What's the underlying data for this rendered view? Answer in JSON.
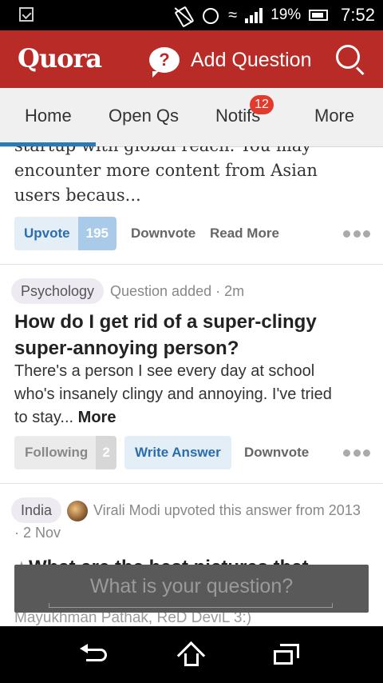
{
  "status_bar": {
    "battery_percent": "19%",
    "time": "7:52"
  },
  "app_bar": {
    "logo": "Quora",
    "add_question_label": "Add Question",
    "add_icon_glyph": "?"
  },
  "tabs": [
    {
      "label": "Home"
    },
    {
      "label": "Open Qs"
    },
    {
      "label": "Notifs",
      "badge": "12"
    },
    {
      "label": "More"
    }
  ],
  "feed": {
    "card1": {
      "cut_line": "startup with global reach. You may",
      "line2": "encounter more content from Asian",
      "line3": "users becaus...",
      "upvote_label": "Upvote",
      "upvote_count": "195",
      "downvote_label": "Downvote",
      "read_more_label": "Read More"
    },
    "card2": {
      "topic": "Psychology",
      "meta": "Question added · 2m",
      "title_line1": "How do I get rid of a super-clingy",
      "title_line2": "super-annoying person?",
      "body_line1": "There's a person I see every day at school",
      "body_line2": "who's insanely clingy and annoying. I've tried",
      "body_line3": "to stay...",
      "more_label": "More",
      "following_label": "Following",
      "following_count": "2",
      "write_answer_label": "Write Answer",
      "downvote_label": "Downvote"
    },
    "card3": {
      "topic": "India",
      "meta_line1": "Virali Modi upvoted this answer from 2013",
      "meta_line2": "· 2 Nov",
      "title_partial": "What are the best pictures that",
      "behind_text": "Mayukhman Pathak, ReD DeviL 3:)"
    }
  },
  "ask_bar": {
    "placeholder": "What is your question?"
  }
}
